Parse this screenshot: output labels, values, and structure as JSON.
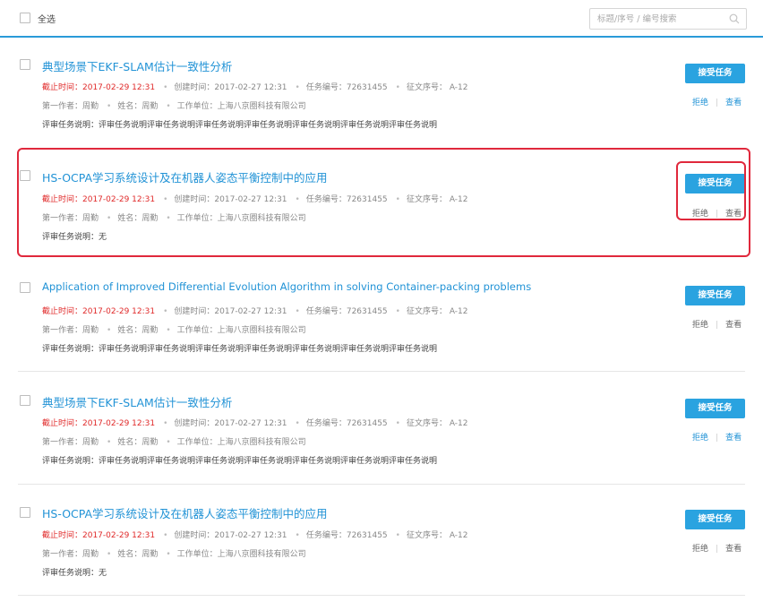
{
  "header": {
    "select_all_label": "全选",
    "search_placeholder": "标题/序号 / 编号搜索"
  },
  "tasks": [
    {
      "title": "典型场景下EKF-SLAM估计一致性分析",
      "deadline": "截止时间：2017-02-29 12:31",
      "created": "创建时间：2017-02-27 12:31",
      "task_no": "任务编号：72631455",
      "essay_no": "征文序号： A-12",
      "first_author": "第一作者：周勤",
      "name": "姓名：周勤",
      "org": "工作单位：上海八京圈科技有限公司",
      "description": "评审任务说明：评审任务说明评审任务说明评审任务说明评审任务说明评审任务说明评审任务说明评审任务说明",
      "accept_label": "接受任务",
      "reject_label": "拒绝",
      "view_label": "查看"
    },
    {
      "title": "HS-OCPA学习系统设计及在机器人姿态平衡控制中的应用",
      "deadline": "截止时间：2017-02-29 12:31",
      "created": "创建时间：2017-02-27 12:31",
      "task_no": "任务编号：72631455",
      "essay_no": "征文序号： A-12",
      "first_author": "第一作者：周勤",
      "name": "姓名：周勤",
      "org": "工作单位：上海八京圈科技有限公司",
      "description": "评审任务说明：无",
      "accept_label": "接受任务",
      "reject_label": "拒绝",
      "view_label": "查看"
    },
    {
      "title": "Application of Improved Differential Evolution Algorithm in solving Container-packing problems",
      "deadline": "截止时间：2017-02-29 12:31",
      "created": "创建时间：2017-02-27 12:31",
      "task_no": "任务编号：72631455",
      "essay_no": "征文序号： A-12",
      "first_author": "第一作者：周勤",
      "name": "姓名：周勤",
      "org": "工作单位：上海八京圈科技有限公司",
      "description": "评审任务说明：评审任务说明评审任务说明评审任务说明评审任务说明评审任务说明评审任务说明评审任务说明",
      "accept_label": "接受任务",
      "reject_label": "拒绝",
      "view_label": "查看"
    },
    {
      "title": "典型场景下EKF-SLAM估计一致性分析",
      "deadline": "截止时间：2017-02-29 12:31",
      "created": "创建时间：2017-02-27 12:31",
      "task_no": "任务编号：72631455",
      "essay_no": "征文序号： A-12",
      "first_author": "第一作者：周勤",
      "name": "姓名：周勤",
      "org": "工作单位：上海八京圈科技有限公司",
      "description": "评审任务说明：评审任务说明评审任务说明评审任务说明评审任务说明评审任务说明评审任务说明评审任务说明",
      "accept_label": "接受任务",
      "reject_label": "拒绝",
      "view_label": "查看"
    },
    {
      "title": "HS-OCPA学习系统设计及在机器人姿态平衡控制中的应用",
      "deadline": "截止时间：2017-02-29 12:31",
      "created": "创建时间：2017-02-27 12:31",
      "task_no": "任务编号：72631455",
      "essay_no": "征文序号： A-12",
      "first_author": "第一作者：周勤",
      "name": "姓名：周勤",
      "org": "工作单位：上海八京圈科技有限公司",
      "description": "评审任务说明：无",
      "accept_label": "接受任务",
      "reject_label": "拒绝",
      "view_label": "查看"
    }
  ],
  "colors": {
    "accent": "#2aa3e0",
    "link": "#2293d6",
    "deadline": "#e02a2a",
    "highlight_box": "#e0283c"
  }
}
